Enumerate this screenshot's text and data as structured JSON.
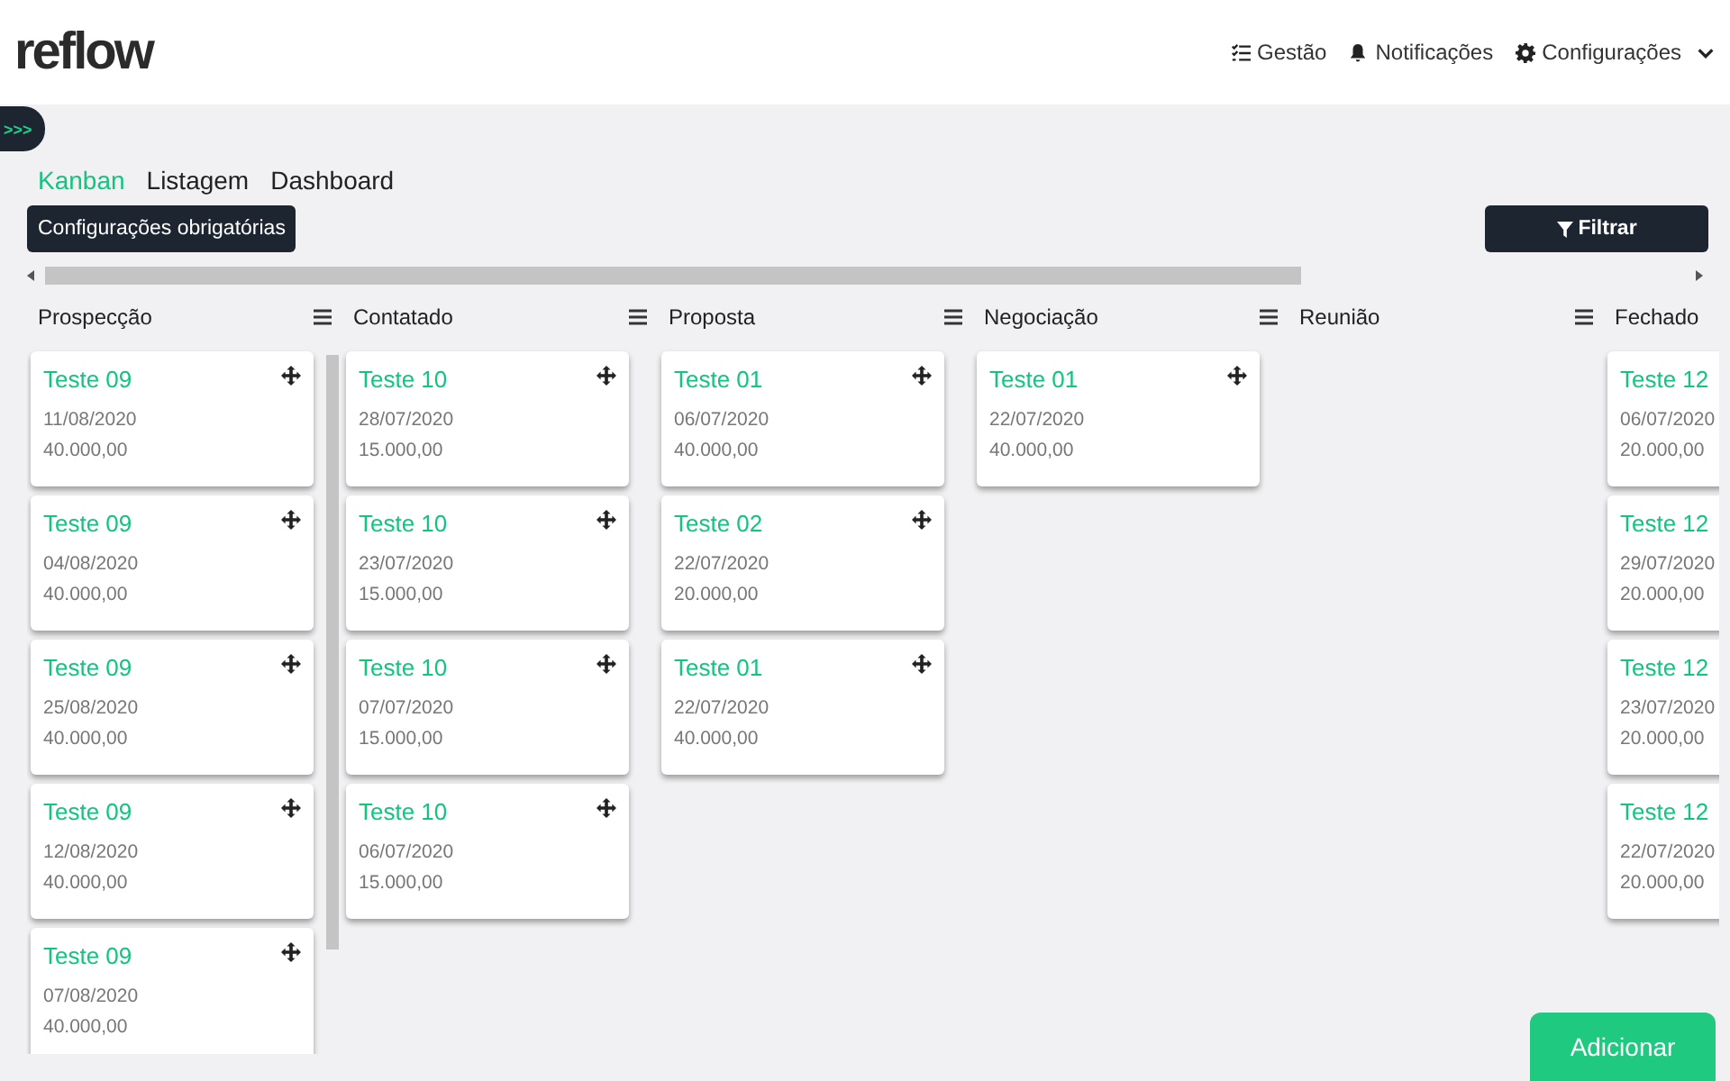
{
  "header": {
    "logo": "reflow",
    "nav": [
      {
        "label": "Gestão",
        "kind": "list"
      },
      {
        "label": "Notificações",
        "kind": "bell"
      },
      {
        "label": "Configurações",
        "kind": "gear"
      }
    ]
  },
  "sidebar_toggle": {
    "label": ">>>"
  },
  "tabs": [
    {
      "label": "Kanban",
      "selected": true
    },
    {
      "label": "Listagem",
      "selected": false
    },
    {
      "label": "Dashboard",
      "selected": false
    }
  ],
  "toolbar": {
    "settings_button": "Configurações obrigatórias",
    "filter_button": "Filtrar"
  },
  "columns": [
    {
      "name": "Prospecção",
      "cards": [
        {
          "title": "Teste 09",
          "date": "11/08/2020",
          "value": "40.000,00"
        },
        {
          "title": "Teste 09",
          "date": "04/08/2020",
          "value": "40.000,00"
        },
        {
          "title": "Teste 09",
          "date": "25/08/2020",
          "value": "40.000,00"
        },
        {
          "title": "Teste 09",
          "date": "12/08/2020",
          "value": "40.000,00"
        },
        {
          "title": "Teste 09",
          "date": "07/08/2020",
          "value": "40.000,00"
        }
      ]
    },
    {
      "name": "Contatado",
      "cards": [
        {
          "title": "Teste 10",
          "date": "28/07/2020",
          "value": "15.000,00"
        },
        {
          "title": "Teste 10",
          "date": "23/07/2020",
          "value": "15.000,00"
        },
        {
          "title": "Teste 10",
          "date": "07/07/2020",
          "value": "15.000,00"
        },
        {
          "title": "Teste 10",
          "date": "06/07/2020",
          "value": "15.000,00"
        }
      ]
    },
    {
      "name": "Proposta",
      "cards": [
        {
          "title": "Teste 01",
          "date": "06/07/2020",
          "value": "40.000,00"
        },
        {
          "title": "Teste 02",
          "date": "22/07/2020",
          "value": "20.000,00"
        },
        {
          "title": "Teste 01",
          "date": "22/07/2020",
          "value": "40.000,00"
        }
      ]
    },
    {
      "name": "Negociação",
      "cards": [
        {
          "title": "Teste 01",
          "date": "22/07/2020",
          "value": "40.000,00"
        }
      ]
    },
    {
      "name": "Reunião"
    },
    {
      "name": "Fechado",
      "cards": [
        {
          "title": "Teste 12",
          "date": "06/07/2020",
          "value": "20.000,00"
        },
        {
          "title": "Teste 12",
          "date": "29/07/2020",
          "value": "20.000,00"
        },
        {
          "title": "Teste 12",
          "date": "23/07/2020",
          "value": "20.000,00"
        },
        {
          "title": "Teste 12",
          "date": "22/07/2020",
          "value": "20.000,00"
        }
      ]
    }
  ],
  "add_button": "Adicionar"
}
